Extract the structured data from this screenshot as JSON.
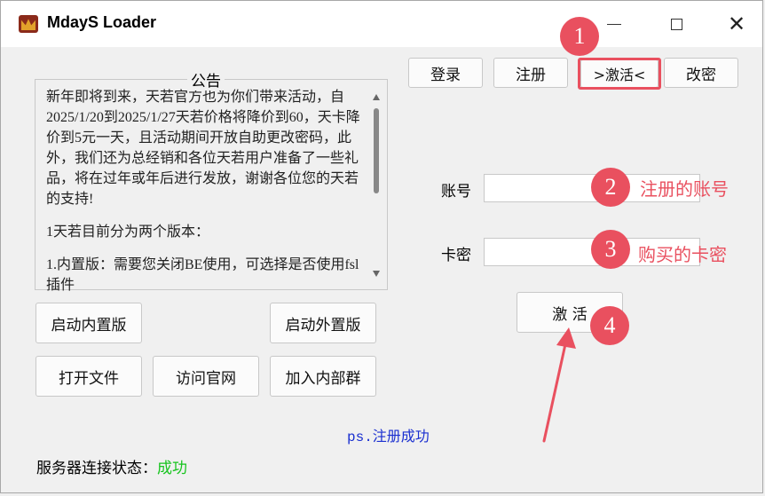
{
  "window": {
    "title": "MdayS Loader"
  },
  "tabs": {
    "login": "登录",
    "register": "注册",
    "activate": ">激活<",
    "change_password": "改密"
  },
  "notice": {
    "title": "公告",
    "paragraphs": [
      "新年即将到来，天若官方也为你们带来活动，自2025/1/20到2025/1/27天若价格将降价到60，天卡降价到5元一天，且活动期间开放自助更改密码，此外，我们还为总经销和各位天若用户准备了一些礼品，将在过年或年后进行发放，谢谢各位您的天若的支持!",
      "1天若目前分为两个版本：",
      "1.内置版：需要您关闭BE使用，可选择是否使用fsl插件"
    ]
  },
  "buttons": {
    "launch_internal": "启动内置版",
    "launch_external": "启动外置版",
    "open_file": "打开文件",
    "visit_site": "访问官网",
    "join_group": "加入内部群",
    "activate": "激 活"
  },
  "form": {
    "account_label": "账号",
    "account_value": "",
    "card_label": "卡密",
    "card_value": ""
  },
  "annotations": {
    "step1": "1",
    "step2": "2",
    "step2_text": "注册的账号",
    "step3": "3",
    "step3_text": "购买的卡密",
    "step4": "4",
    "color": "#e9505f"
  },
  "status": {
    "message": "ps.注册成功",
    "label": "服务器连接状态：",
    "value": "成功",
    "value_color": "#16c41d"
  }
}
